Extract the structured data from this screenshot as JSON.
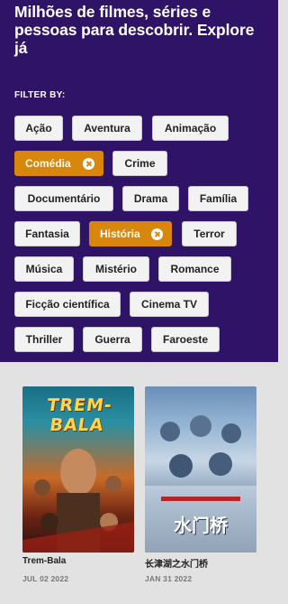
{
  "hero": {
    "heading": "Milhões de filmes, séries e pessoas para descobrir. Explore já",
    "filter_label": "FILTER BY:"
  },
  "genres": [
    {
      "label": "Ação",
      "active": false
    },
    {
      "label": "Aventura",
      "active": false
    },
    {
      "label": "Animação",
      "active": false
    },
    {
      "label": "Comédia",
      "active": true
    },
    {
      "label": "Crime",
      "active": false
    },
    {
      "label": "Documentário",
      "active": false
    },
    {
      "label": "Drama",
      "active": false
    },
    {
      "label": "Família",
      "active": false
    },
    {
      "label": "Fantasia",
      "active": false
    },
    {
      "label": "História",
      "active": true
    },
    {
      "label": "Terror",
      "active": false
    },
    {
      "label": "Música",
      "active": false
    },
    {
      "label": "Mistério",
      "active": false
    },
    {
      "label": "Romance",
      "active": false
    },
    {
      "label": "Ficção científica",
      "active": false
    },
    {
      "label": "Cinema TV",
      "active": false
    },
    {
      "label": "Thriller",
      "active": false
    },
    {
      "label": "Guerra",
      "active": false
    },
    {
      "label": "Faroeste",
      "active": false
    }
  ],
  "movies": [
    {
      "title": "Trem-Bala",
      "date": "JUL 02 2022",
      "poster_text": "TREM-BALA"
    },
    {
      "title": "长津湖之水门桥",
      "date": "JAN 31 2022",
      "poster_text": "水门桥"
    }
  ],
  "colors": {
    "hero_bg": "#2e1366",
    "chip_bg": "#f2f2f2",
    "chip_active": "#d9860c",
    "page_bg": "#e2e2e2"
  }
}
